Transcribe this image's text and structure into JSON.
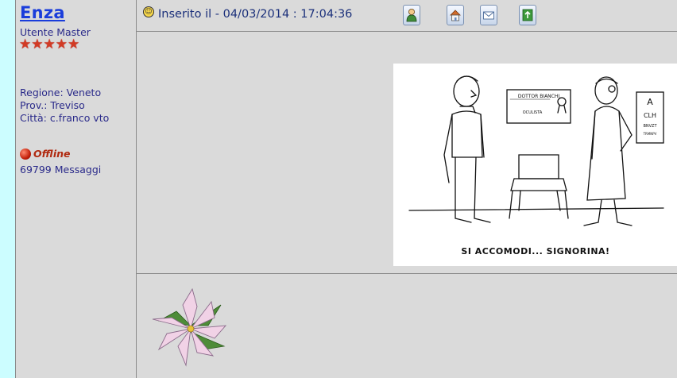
{
  "author": {
    "username": "Enza",
    "rank": "Utente Master",
    "stars": [
      "★",
      "★",
      "★",
      "★",
      "★"
    ],
    "region": "Regione: Veneto",
    "province": "Prov.: Treviso",
    "city": "Città: c.franco vto",
    "status": "Offline",
    "messages": "69799 Messaggi"
  },
  "post": {
    "posted_label": "Inserito il - 04/03/2014 : 17:04:36",
    "actions": [
      {
        "icon": "profile-icon"
      },
      {
        "icon": "home-icon"
      },
      {
        "icon": "email-icon"
      },
      {
        "icon": "reply-icon"
      }
    ],
    "cartoon": {
      "sign": "DOTTOR BIANCHI",
      "sign_sub": "OCULISTA",
      "chart": [
        "A",
        "CLH",
        "BNVZT",
        "TRMNPV"
      ],
      "caption": "SI ACCOMODI... SIGNORINA!"
    }
  },
  "colors": {
    "page_bg": "#ccfdff",
    "panel_bg": "#dadada",
    "link": "#1a3ddb",
    "text": "#2a2a8a",
    "star": "#d23a24"
  }
}
